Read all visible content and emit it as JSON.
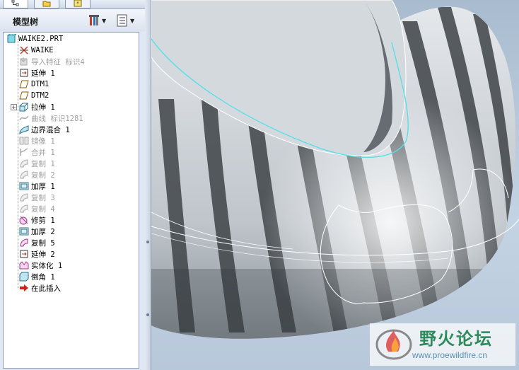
{
  "top_tabs": [
    {
      "name": "tab-model-tree",
      "icon": "tree-structure-icon"
    },
    {
      "name": "tab-folder-browser",
      "icon": "folder-icon"
    },
    {
      "name": "tab-favorites",
      "icon": "star-icon"
    }
  ],
  "header": {
    "title": "模型树",
    "settings_icon": "tools-icon",
    "show_icon": "list-icon"
  },
  "tree": {
    "root": {
      "label": "WAIKE2.PRT",
      "icon": "part-icon"
    },
    "items": [
      {
        "label": "WAIKE",
        "icon": "csys-icon",
        "disabled": false,
        "expander": false
      },
      {
        "label": "导入特征 标识4",
        "icon": "import-icon",
        "disabled": true,
        "expander": false
      },
      {
        "label": "延伸 1",
        "icon": "extend-icon",
        "disabled": false,
        "expander": false
      },
      {
        "label": "DTM1",
        "icon": "datum-plane-icon",
        "disabled": false,
        "expander": false
      },
      {
        "label": "DTM2",
        "icon": "datum-plane-icon",
        "disabled": false,
        "expander": false
      },
      {
        "label": "拉伸 1",
        "icon": "extrude-icon",
        "disabled": false,
        "expander": true
      },
      {
        "label": "曲线 标识1281",
        "icon": "curve-icon",
        "disabled": true,
        "expander": false
      },
      {
        "label": "边界混合 1",
        "icon": "boundary-blend-icon",
        "disabled": false,
        "expander": false
      },
      {
        "label": "镜像 1",
        "icon": "mirror-icon",
        "disabled": true,
        "expander": false
      },
      {
        "label": "合并 1",
        "icon": "merge-icon",
        "disabled": true,
        "expander": false
      },
      {
        "label": "复制 1",
        "icon": "copy-icon",
        "disabled": true,
        "expander": false
      },
      {
        "label": "复制 2",
        "icon": "copy-icon",
        "disabled": true,
        "expander": false
      },
      {
        "label": "加厚 1",
        "icon": "thicken-icon",
        "disabled": false,
        "expander": false
      },
      {
        "label": "复制 3",
        "icon": "copy-icon",
        "disabled": true,
        "expander": false
      },
      {
        "label": "复制 4",
        "icon": "copy-icon",
        "disabled": true,
        "expander": false
      },
      {
        "label": "修剪 1",
        "icon": "trim-icon",
        "disabled": false,
        "expander": false
      },
      {
        "label": "加厚 2",
        "icon": "thicken-icon",
        "disabled": false,
        "expander": false
      },
      {
        "label": "复制 5",
        "icon": "copy-icon",
        "disabled": false,
        "expander": false
      },
      {
        "label": "延伸 2",
        "icon": "extend-icon",
        "disabled": false,
        "expander": false
      },
      {
        "label": "实体化 1",
        "icon": "solidify-icon",
        "disabled": false,
        "expander": false
      },
      {
        "label": "倒角 1",
        "icon": "chamfer-icon",
        "disabled": false,
        "expander": false
      },
      {
        "label": "在此插入",
        "icon": "insert-arrow-icon",
        "disabled": false,
        "expander": false
      }
    ]
  },
  "watermark": {
    "title": "野火论坛",
    "url": "www.proewildfire.cn"
  },
  "colors": {
    "accent_cyan": "#4fe0e8",
    "insert_arrow": "#d0201a",
    "watermark_green": "#2d8a5a"
  }
}
